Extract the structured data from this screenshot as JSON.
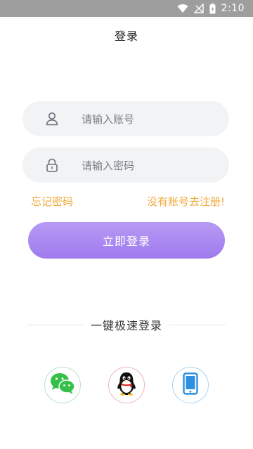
{
  "status_bar": {
    "time": "2:10"
  },
  "header": {
    "title": "登录"
  },
  "form": {
    "account_placeholder": "请输入账号",
    "password_placeholder": "请输入密码",
    "forgot_password": "忘记密码",
    "register_link": "没有账号去注册!",
    "login_button": "立即登录"
  },
  "quick_login": {
    "title": "一键极速登录",
    "options": [
      {
        "icon": "wechat-icon",
        "color": "#35c04a"
      },
      {
        "icon": "qq-icon",
        "color": "#111111"
      },
      {
        "icon": "phone-icon",
        "color": "#2e8fe0"
      }
    ]
  },
  "colors": {
    "accent_purple": "#a283ef",
    "link_orange": "#f2a83b",
    "field_bg": "#f1f3f5"
  }
}
